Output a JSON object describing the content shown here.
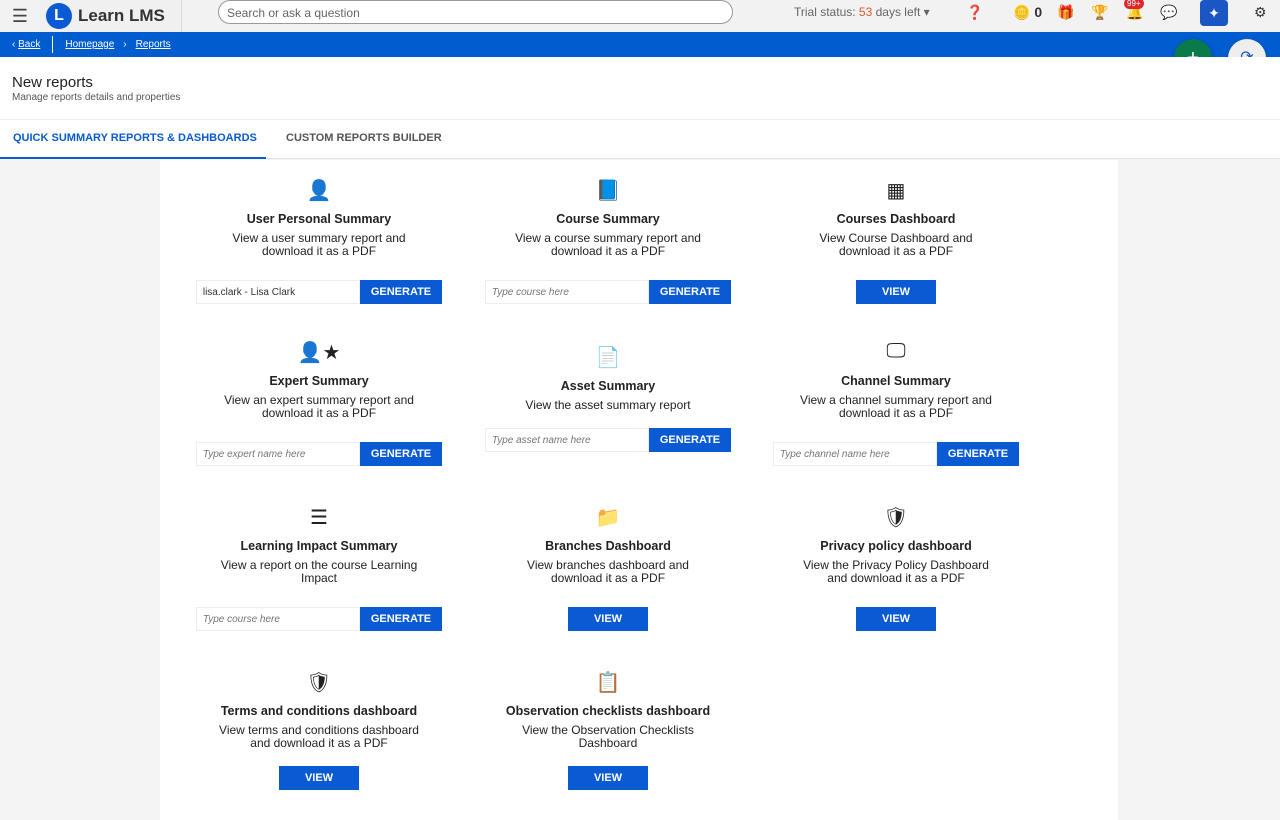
{
  "app": {
    "name": "Learn LMS",
    "search_placeholder": "Search or ask a question",
    "trial_label": "Trial status:",
    "trial_days": "53",
    "trial_suffix": "days left",
    "points": "0",
    "notifications": "99+"
  },
  "breadcrumb": {
    "back": "Back",
    "items": [
      "Homepage",
      "Reports"
    ]
  },
  "page": {
    "title": "New reports",
    "subtitle": "Manage reports details and properties"
  },
  "tabs": [
    "QUICK SUMMARY REPORTS & DASHBOARDS",
    "CUSTOM REPORTS BUILDER"
  ],
  "cards": [
    {
      "title": "User Personal Summary",
      "desc": "View a user summary report and download it as a PDF",
      "value": "lisa.clark - Lisa Clark",
      "placeholder": "",
      "button": "GENERATE"
    },
    {
      "title": "Course Summary",
      "desc": "View a course summary report and download it as a PDF",
      "value": "",
      "placeholder": "Type course here",
      "button": "GENERATE"
    },
    {
      "title": "Courses Dashboard",
      "desc": "View Course Dashboard and download it as a PDF",
      "button": "VIEW"
    },
    {
      "title": "Expert Summary",
      "desc": "View an expert summary report and download it as a PDF",
      "value": "",
      "placeholder": "Type expert name here",
      "button": "GENERATE"
    },
    {
      "title": "Asset Summary",
      "desc": "View the asset summary report",
      "value": "",
      "placeholder": "Type asset name here",
      "button": "GENERATE"
    },
    {
      "title": "Channel Summary",
      "desc": "View a channel summary report and download it as a PDF",
      "value": "",
      "placeholder": "Type channel name here",
      "button": "GENERATE"
    },
    {
      "title": "Learning Impact Summary",
      "desc": "View a report on the course Learning Impact",
      "value": "",
      "placeholder": "Type course here",
      "button": "GENERATE"
    },
    {
      "title": "Branches Dashboard",
      "desc": "View branches dashboard and download it as a PDF",
      "button": "VIEW"
    },
    {
      "title": "Privacy policy dashboard",
      "desc": "View the Privacy Policy Dashboard and download it as a PDF",
      "button": "VIEW"
    },
    {
      "title": "Terms and conditions dashboard",
      "desc": "View terms and conditions dashboard and download it as a PDF",
      "button": "VIEW"
    },
    {
      "title": "Observation checklists dashboard",
      "desc": "View the Observation Checklists Dashboard",
      "button": "VIEW"
    }
  ]
}
